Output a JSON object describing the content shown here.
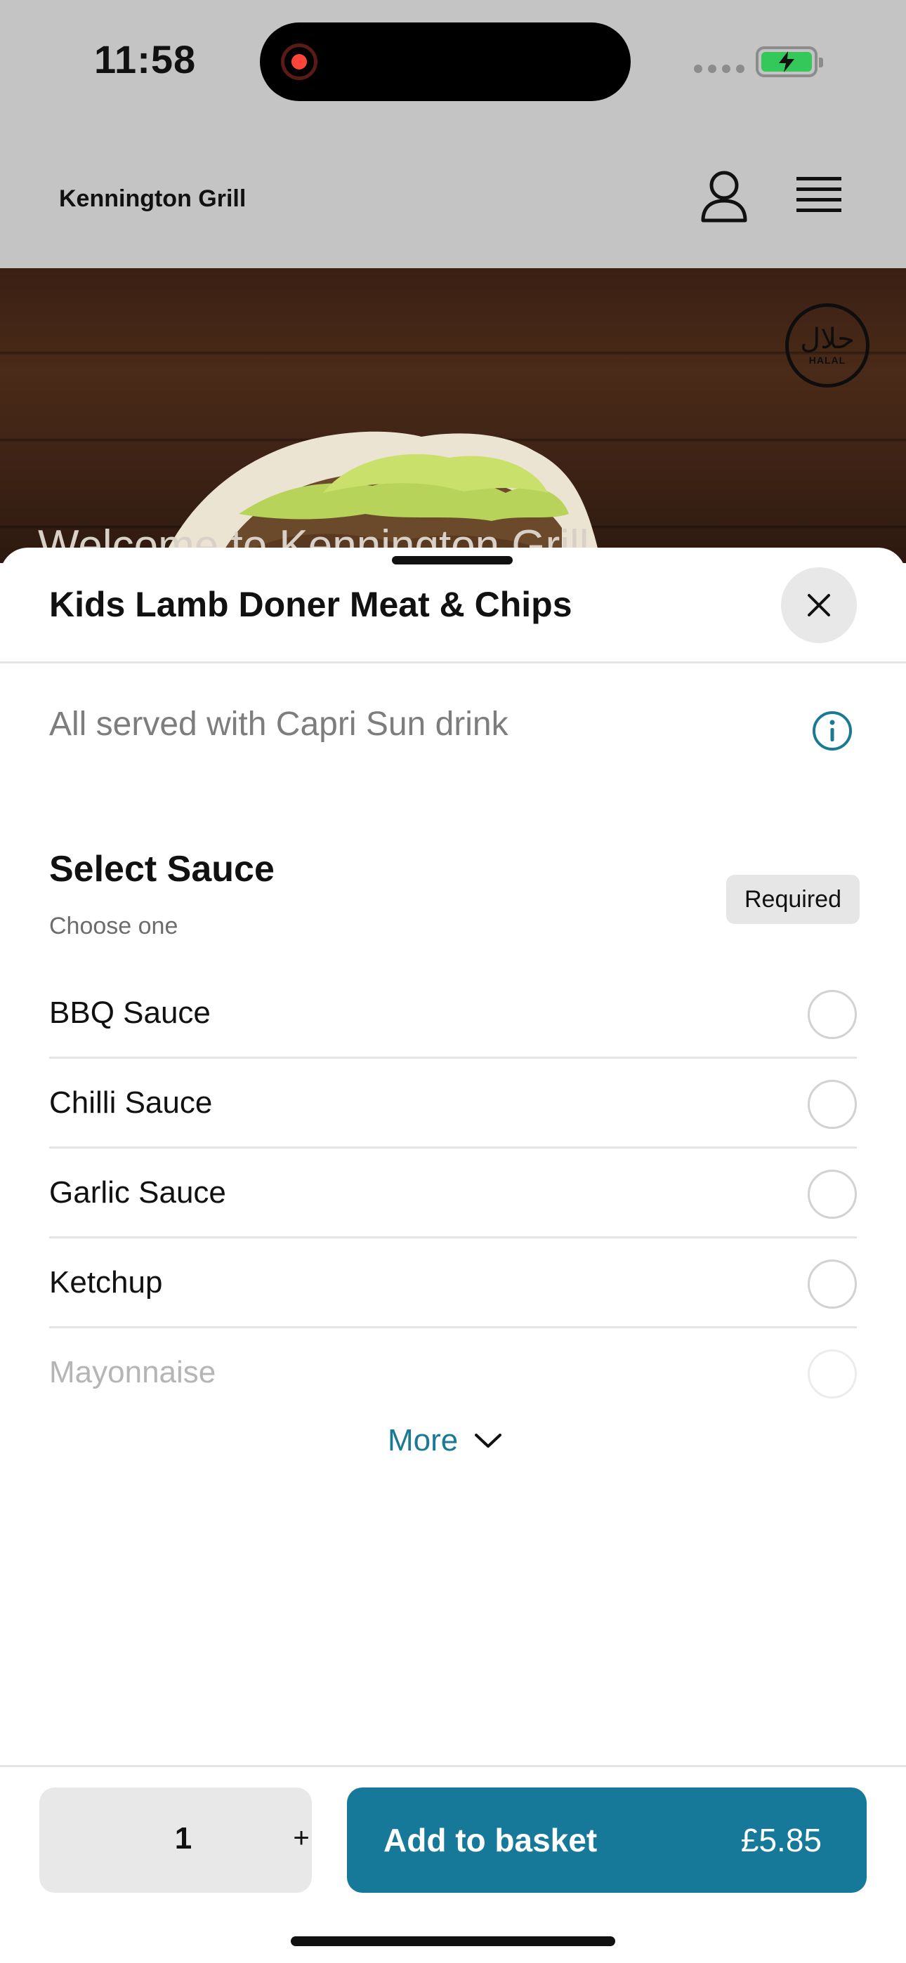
{
  "status_bar": {
    "time": "11:58",
    "battery_color": "#34c759",
    "recording_color": "#ff453a"
  },
  "header": {
    "restaurant_name": "Kennington Grill",
    "account_icon": "person-icon",
    "menu_icon": "hamburger-menu-icon"
  },
  "hero": {
    "badge_arabic": "حلال",
    "badge_text": "HALAL",
    "welcome_text": "Welcome to Kennington Grill"
  },
  "modal": {
    "title": "Kids Lamb Doner Meat & Chips",
    "description": "All served with Capri Sun drink",
    "close_icon": "close-icon",
    "info_icon": "info-icon",
    "section": {
      "title": "Select Sauce",
      "subtitle": "Choose one",
      "badge": "Required",
      "options": [
        {
          "label": "BBQ Sauce"
        },
        {
          "label": "Chilli Sauce"
        },
        {
          "label": "Garlic Sauce"
        },
        {
          "label": "Ketchup"
        },
        {
          "label": "Mayonnaise"
        }
      ],
      "more_label": "More"
    }
  },
  "footer": {
    "quantity": "1",
    "plus_label": "+",
    "add_label": "Add to basket",
    "price": "£5.85",
    "accent_color": "#17799a"
  }
}
